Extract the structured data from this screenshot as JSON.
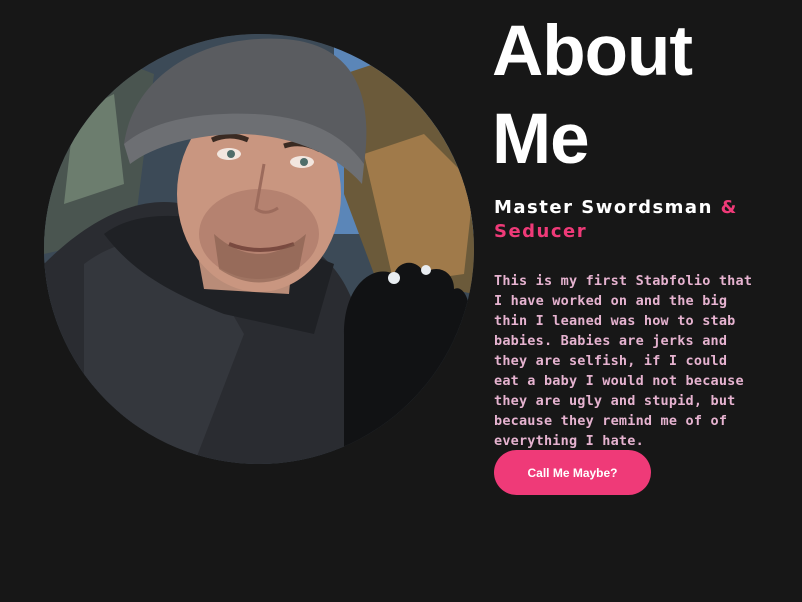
{
  "about": {
    "title": "About Me",
    "subtitle_main": "Master Swordsman ",
    "subtitle_accent": "& Seducer",
    "bio": "This is my first Stabfolio that I have worked on and the big thin I leaned was how to stab babies. Babies are jerks and they are selfish, if I could eat a baby I would not because they are ugly and stupid, but because they remind me of of everything I hate.",
    "cta_label": "Call Me Maybe?"
  },
  "colors": {
    "background": "#171717",
    "accent": "#ef3a78",
    "bio_text": "#e6b3d0",
    "heading": "#ffffff"
  }
}
